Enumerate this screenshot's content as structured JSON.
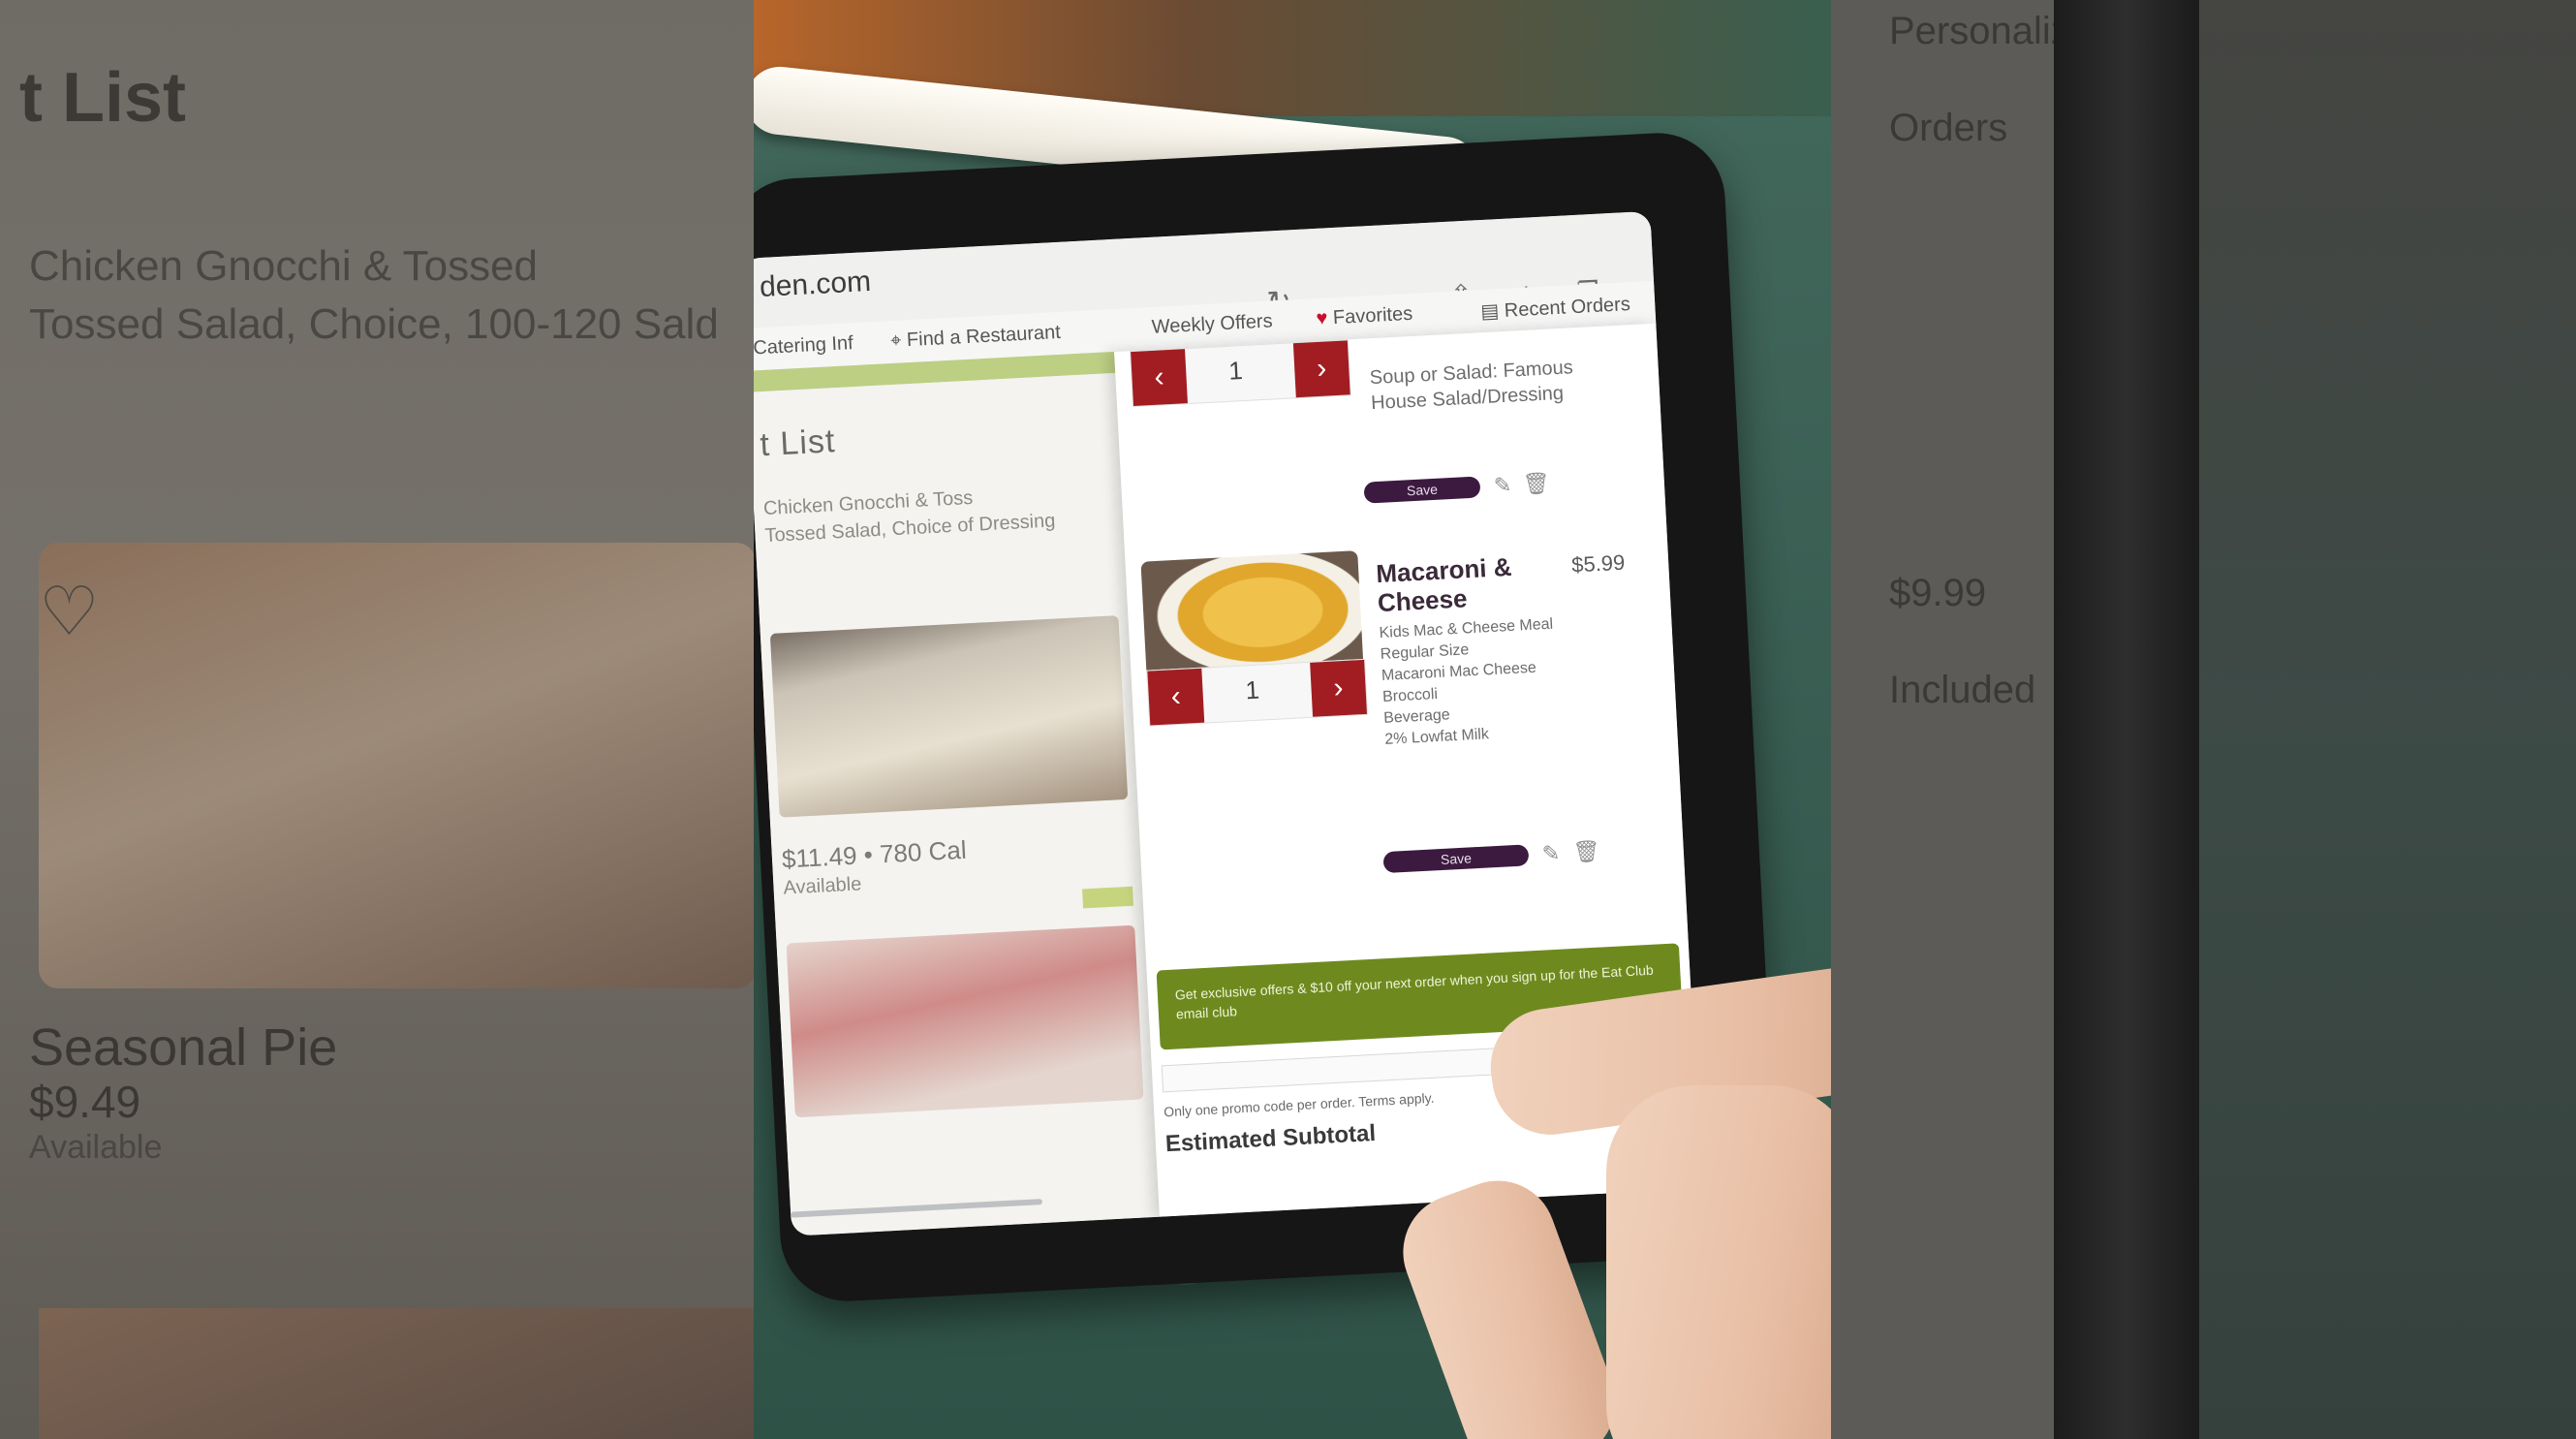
{
  "ghost_left": {
    "title": "t List",
    "lines": [
      "Chicken Gnocchi & Tossed",
      "Tossed Salad, Choice, 100-120 Sald"
    ],
    "item_name": "Seasonal Pie",
    "item_price": "$9.49",
    "item_note": "Available"
  },
  "ghost_right": {
    "top": "Personalize Item",
    "lines": [
      "Orders",
      "$9.99",
      "Included"
    ]
  },
  "browser": {
    "url": "den.com",
    "nav": {
      "item1": "Catering Inf",
      "item2": "Find a Restaurant",
      "item3": "Weekly Offers",
      "item4": "Favorites",
      "item5": "Recent Orders"
    }
  },
  "list_page": {
    "title": "t List",
    "lines": [
      "Chicken Gnocchi & Toss",
      "Tossed Salad, Choice of Dressing"
    ],
    "price": "$11.49 • 780 Cal",
    "note": "Available"
  },
  "cart": {
    "items": [
      {
        "qty": "1",
        "details": [
          "Soup or Salad: Famous",
          "House Salad/Dressing"
        ],
        "save_label": "Save"
      },
      {
        "qty": "1",
        "name_line1": "Macaroni &",
        "name_line2": "Cheese",
        "price": "$5.99",
        "details": [
          "Kids Mac & Cheese Meal",
          "Regular Size",
          "Macaroni Mac Cheese",
          "Broccoli",
          "Beverage",
          "2% Lowfat Milk"
        ],
        "save_label": "Save"
      }
    ],
    "minus": "‹",
    "plus": "›",
    "edit_icon": "pencil-icon",
    "trash_icon": "trash-icon",
    "promo_text": "Get exclusive offers & $10 off your next order when you sign up for the Eat Club email club",
    "terms": "Only one promo code per order. Terms apply.",
    "subtotal_label": "Estimated Subtotal"
  }
}
